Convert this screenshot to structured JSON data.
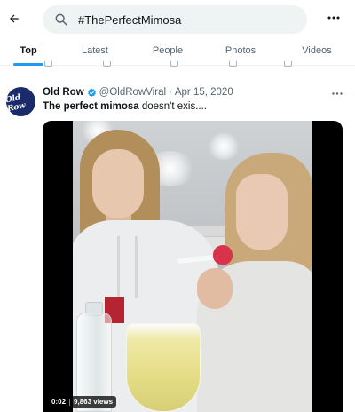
{
  "search": {
    "query": "#ThePerfectMimosa"
  },
  "tabs": [
    {
      "label": "Top",
      "active": true
    },
    {
      "label": "Latest",
      "active": false
    },
    {
      "label": "People",
      "active": false
    },
    {
      "label": "Photos",
      "active": false
    },
    {
      "label": "Videos",
      "active": false
    }
  ],
  "icons": {
    "back": "arrow-left-icon",
    "search": "search-icon",
    "more": "more-horizontal-icon",
    "verified": "verified-badge-icon"
  },
  "colors": {
    "accent": "#1d9bf0",
    "avatar_bg": "#1b2a6b"
  },
  "tweet": {
    "avatar_text": "Old Row",
    "display_name": "Old Row",
    "handle": "@OldRowViral",
    "separator": "·",
    "date": "Apr 15, 2020",
    "text_bold": "The perfect mimosa",
    "text_rest": " doesn't exis....",
    "media": {
      "duration": "0:02",
      "views": "9,863 views"
    }
  }
}
